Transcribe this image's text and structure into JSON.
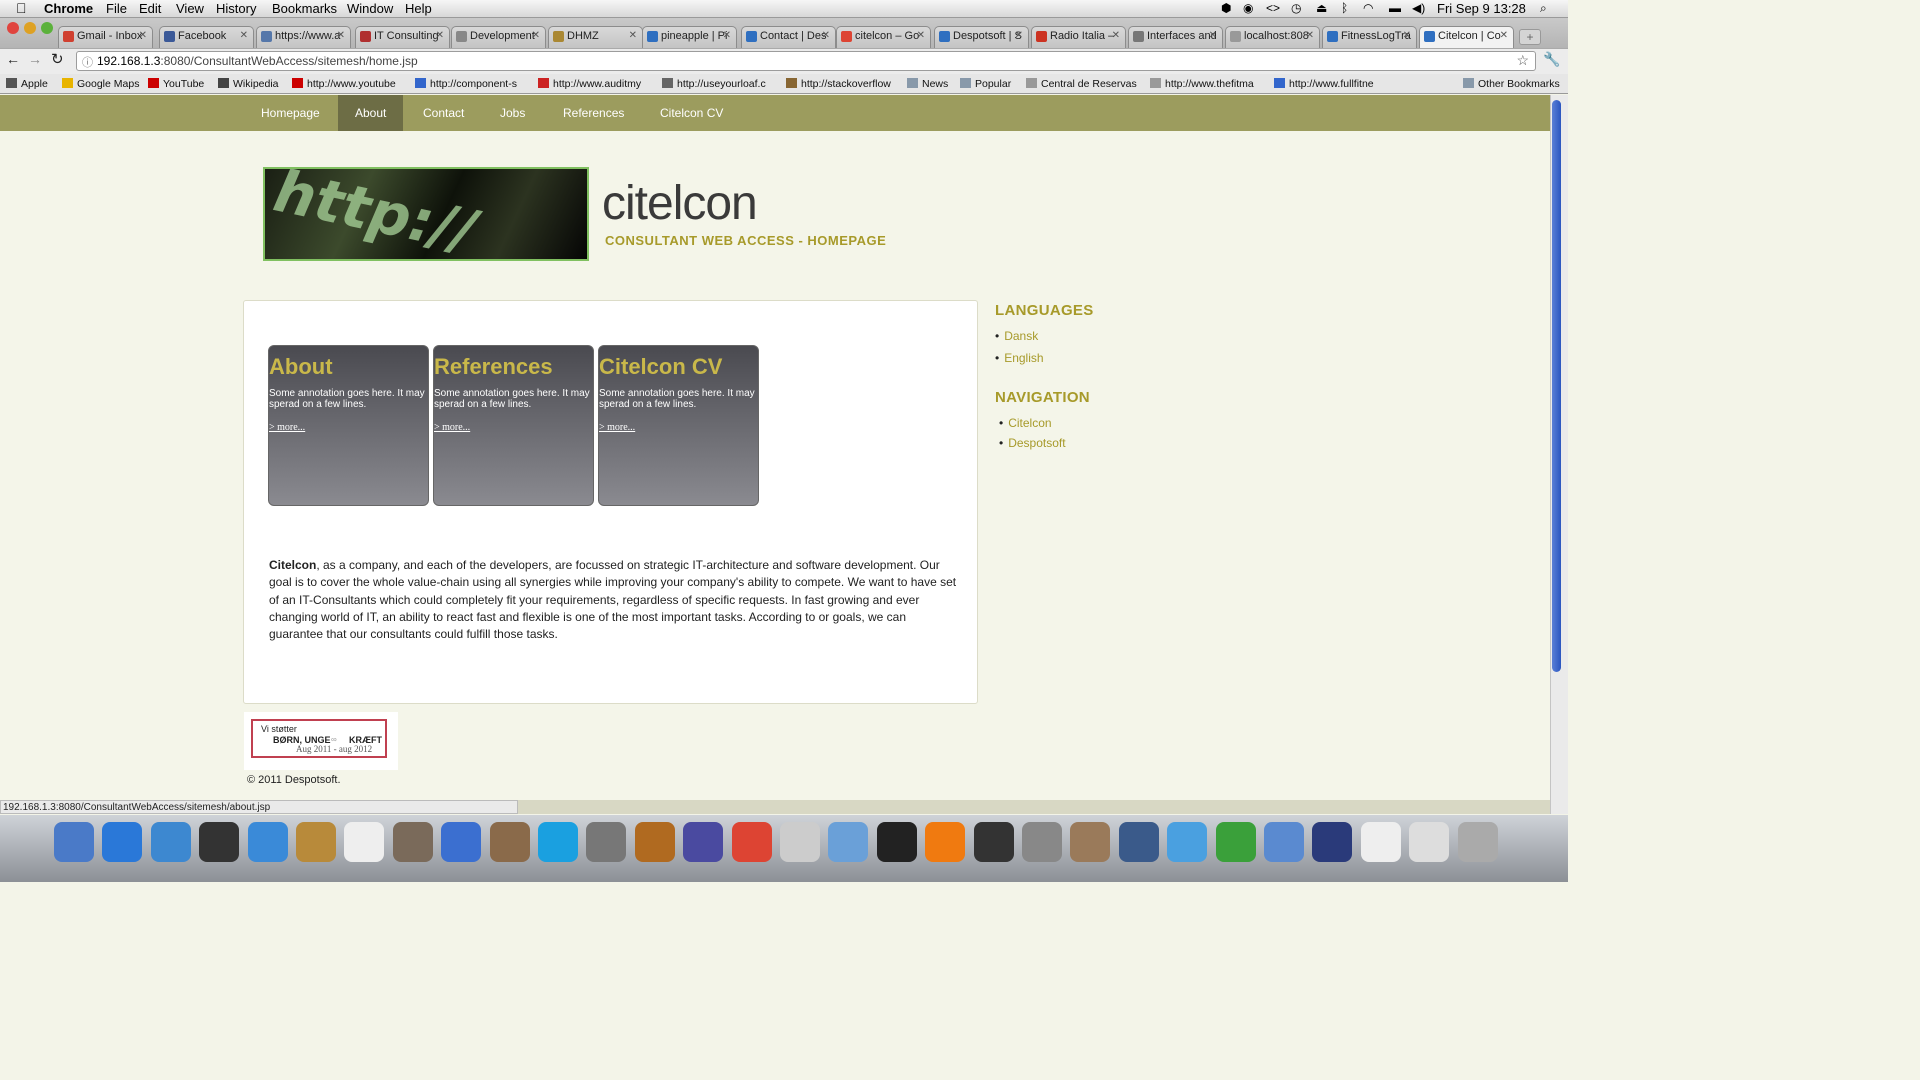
{
  "menubar": {
    "app": "Chrome",
    "items": [
      "File",
      "Edit",
      "View",
      "History",
      "Bookmarks",
      "Window",
      "Help"
    ],
    "clock": "Fri Sep 9  13:28"
  },
  "tabs": [
    {
      "label": "Gmail - Inbox",
      "color": "#d04030"
    },
    {
      "label": "Facebook",
      "color": "#3b5998"
    },
    {
      "label": "https://www.a",
      "color": "#5577aa"
    },
    {
      "label": "IT Consulting",
      "color": "#b03030"
    },
    {
      "label": "Development",
      "color": "#888888"
    },
    {
      "label": "DHMZ",
      "color": "#aa8833"
    },
    {
      "label": "pineapple | Pi",
      "color": "#2f6fc0"
    },
    {
      "label": "Contact | Des",
      "color": "#2f6fc0"
    },
    {
      "label": "citelcon – Go",
      "color": "#dd4433"
    },
    {
      "label": "Despotsoft | S",
      "color": "#2f6fc0"
    },
    {
      "label": "Radio Italia –",
      "color": "#cc3322"
    },
    {
      "label": "Interfaces and",
      "color": "#777777"
    },
    {
      "label": "localhost:808",
      "color": "#999999"
    },
    {
      "label": "FitnessLogTra",
      "color": "#2f6fc0"
    },
    {
      "label": "Citelcon | Co",
      "color": "#2f6fc0"
    }
  ],
  "address": {
    "host": "192.168.1.3",
    "rest": ":8080/ConsultantWebAccess/sitemesh/home.jsp"
  },
  "bookmarks": [
    "Apple",
    "Google Maps",
    "YouTube",
    "Wikipedia",
    "http://www.youtube",
    "http://component-s",
    "http://www.auditmy",
    "http://useyourloaf.c",
    "http://stackoverflow",
    "News",
    "Popular",
    "Central de Reservas",
    "http://www.thefitma",
    "http://www.fullfitne",
    "Other Bookmarks"
  ],
  "site": {
    "nav": [
      "Homepage",
      "About",
      "Contact",
      "Jobs",
      "References",
      "Citelcon CV"
    ],
    "active_nav": "About",
    "banner_text": "http://",
    "name": "citelcon",
    "subtitle": "CONSULTANT WEB ACCESS - HOMEPAGE",
    "cards": [
      {
        "title": "About",
        "text": "Some annotation goes here. It may sperad on a few lines.",
        "link": "> more..."
      },
      {
        "title": "References",
        "text": "Some annotation goes here. It may sperad on a few lines.",
        "link": "> more..."
      },
      {
        "title": "Citelcon CV",
        "text": "Some annotation goes here. It may sperad on a few lines.",
        "link": "> more..."
      }
    ],
    "body_lead": "Citelcon",
    "body_text": ", as a company, and each of the developers, are focussed on strategic IT-architecture and software development. Our goal is to cover the whole value-chain using all synergies while improving your company's ability to compete. We want to have set of an IT-Consultants which could completely fit your requirements, regardless of specific requests. In fast growing and ever changing world of IT, an ability to react fast and flexible is one of the most important tasks. According to or goals, we can guarantee that our consultants could fulfill those tasks.",
    "languages_heading": "LANGUAGES",
    "languages": [
      "Dansk",
      "English"
    ],
    "navigation_heading": "NAVIGATION",
    "navigation": [
      "Citelcon",
      "Despotsoft"
    ],
    "badge": {
      "line1": "Vi støtter",
      "line2": "BØRN, UNGE",
      "line3": "KRÆFT",
      "line4": "Aug 2011 - aug 2012"
    },
    "footer": "© 2011 Despotsoft."
  },
  "status_url": "192.168.1.3:8080/ConsultantWebAccess/sitemesh/about.jsp",
  "colors": {
    "nav_bg": "#9c9c5e",
    "nav_active": "#6d6d45",
    "accent": "#a79a2a"
  }
}
